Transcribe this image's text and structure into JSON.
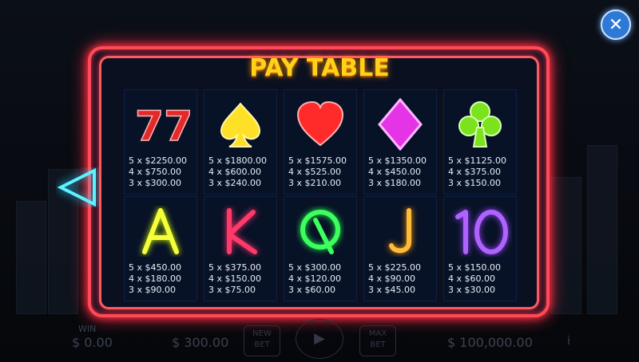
{
  "title": "PAY TABLE",
  "close_label": "✕",
  "back_label": "◁",
  "symbols": [
    {
      "icon": "seven-seven-icon",
      "pays": [
        "5 x $2250.00",
        "4 x $750.00",
        "3 x $300.00"
      ]
    },
    {
      "icon": "spade-icon",
      "pays": [
        "5 x $1800.00",
        "4 x $600.00",
        "3 x $240.00"
      ]
    },
    {
      "icon": "heart-icon",
      "pays": [
        "5 x $1575.00",
        "4 x $525.00",
        "3 x $210.00"
      ]
    },
    {
      "icon": "diamond-icon",
      "pays": [
        "5 x $1350.00",
        "4 x $450.00",
        "3 x $180.00"
      ]
    },
    {
      "icon": "club-icon",
      "pays": [
        "5 x $1125.00",
        "4 x $375.00",
        "3 x $150.00"
      ]
    },
    {
      "icon": "a-icon",
      "pays": [
        "5 x $450.00",
        "4 x $180.00",
        "3 x $90.00"
      ]
    },
    {
      "icon": "k-icon",
      "pays": [
        "5 x $375.00",
        "4 x $150.00",
        "3 x $75.00"
      ]
    },
    {
      "icon": "q-icon",
      "pays": [
        "5 x $300.00",
        "4 x $120.00",
        "3 x $60.00"
      ]
    },
    {
      "icon": "j-icon",
      "pays": [
        "5 x $225.00",
        "4 x $90.00",
        "3 x $45.00"
      ]
    },
    {
      "icon": "ten-icon",
      "pays": [
        "5 x $150.00",
        "4 x $60.00",
        "3 x $30.00"
      ]
    }
  ],
  "bottom": {
    "win_label": "WIN",
    "win_value": "$ 0.00",
    "bet_value": "$ 300.00",
    "new_bet_label": "NEW BET",
    "max_bet_label": "MAX BET",
    "balance_value": "$ 100,000.00"
  },
  "colors": {
    "neon": "#ff4b57",
    "title": "#ffd21a",
    "close": "#2f79d6"
  }
}
